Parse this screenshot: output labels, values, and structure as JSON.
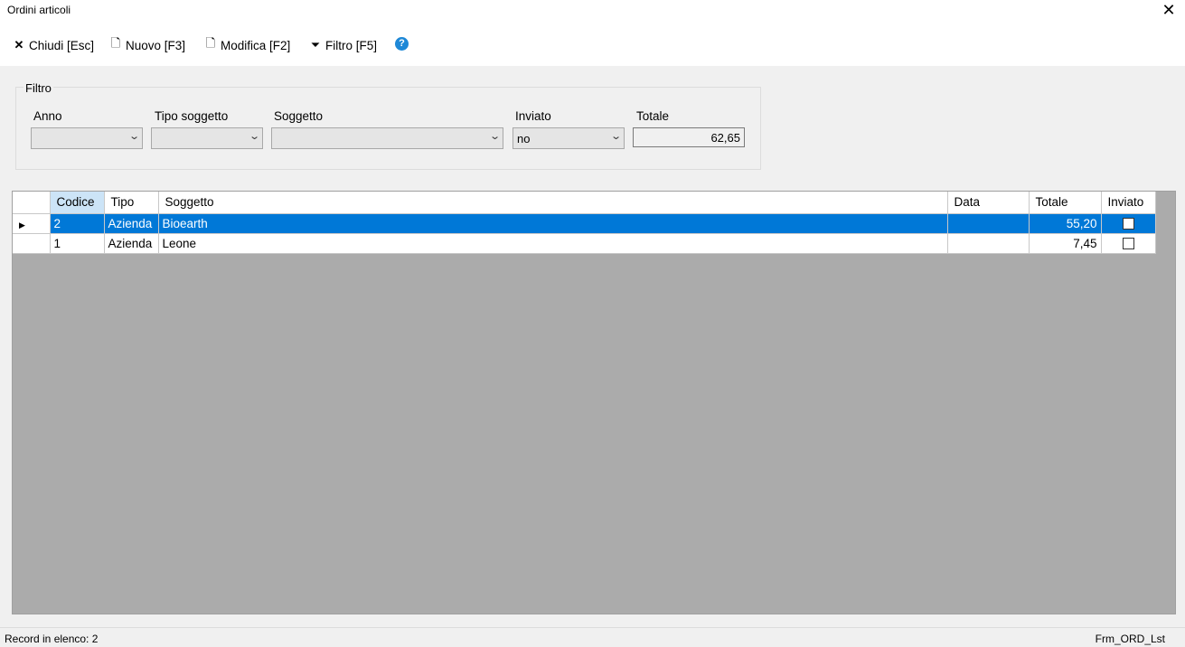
{
  "window": {
    "title": "Ordini articoli"
  },
  "toolbar": {
    "close_label": "Chiudi [Esc]",
    "new_label": "Nuovo [F3]",
    "edit_label": "Modifica [F2]",
    "filter_label": "Filtro [F5]",
    "help_glyph": "?"
  },
  "filter": {
    "legend": "Filtro",
    "anno_label": "Anno",
    "anno_value": "",
    "tipo_label": "Tipo soggetto",
    "tipo_value": "",
    "soggetto_label": "Soggetto",
    "soggetto_value": "",
    "inviato_label": "Inviato",
    "inviato_value": "no",
    "totale_label": "Totale",
    "totale_value": "62,65"
  },
  "grid": {
    "headers": [
      "Codice",
      "Tipo",
      "Soggetto",
      "Data",
      "Totale",
      "Inviato"
    ],
    "rows": [
      {
        "codice": "2",
        "tipo": "Azienda",
        "soggetto": "Bioearth",
        "data": "",
        "totale": "55,20",
        "inviato": false,
        "selected": true
      },
      {
        "codice": "1",
        "tipo": "Azienda",
        "soggetto": "Leone",
        "data": "",
        "totale": "7,45",
        "inviato": false,
        "selected": false
      }
    ]
  },
  "status": {
    "records": "Record in elenco: 2",
    "form_name": "Frm_ORD_Lst"
  },
  "colors": {
    "selection": "#0078d7",
    "sorted_header": "#cce4f7",
    "grid_bg": "#ababab"
  },
  "icons": [
    "close-icon",
    "new-document-icon",
    "edit-document-icon",
    "filter-icon",
    "help-icon",
    "chevron-down-icon",
    "row-pointer-icon",
    "checkbox"
  ]
}
